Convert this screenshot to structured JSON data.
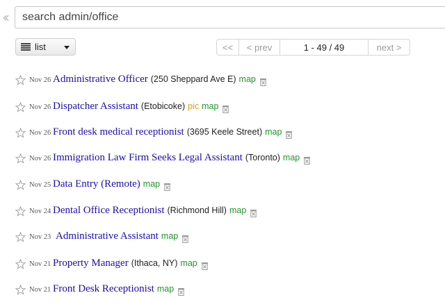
{
  "search": {
    "placeholder": "search admin/office"
  },
  "view_mode": {
    "selected": "list"
  },
  "pager": {
    "first": "<<",
    "prev": "< prev",
    "range": "1 - 49 / 49",
    "next": "next >"
  },
  "postings": [
    {
      "date": "Nov 26",
      "title": "Administrative Officer",
      "location": "(250 Sheppard Ave E)",
      "pic": "",
      "map": "map"
    },
    {
      "date": "Nov 26",
      "title": "Dispatcher Assistant",
      "location": "(Etobicoke)",
      "pic": "pic",
      "map": "map"
    },
    {
      "date": "Nov 26",
      "title": "Front desk medical receptionist",
      "location": "(3695 Keele Street)",
      "pic": "",
      "map": "map"
    },
    {
      "date": "Nov 26",
      "title": "Immigration Law Firm Seeks Legal Assistant",
      "location": "(Toronto)",
      "pic": "",
      "map": "map"
    },
    {
      "date": "Nov 25",
      "title": "Data Entry (Remote)",
      "location": "",
      "pic": "",
      "map": "map"
    },
    {
      "date": "Nov 24",
      "title": "Dental Office Receptionist",
      "location": "(Richmond Hill)",
      "pic": "",
      "map": "map"
    },
    {
      "date": "Nov 23",
      "title": "Administrative Assistant",
      "location": "",
      "pic": "",
      "map": "map"
    },
    {
      "date": "Nov 21",
      "title": "Property Manager",
      "location": "(Ithaca, NY)",
      "pic": "",
      "map": "map"
    },
    {
      "date": "Nov 21",
      "title": "Front Desk Receptionist",
      "location": "",
      "pic": "",
      "map": "map"
    }
  ]
}
